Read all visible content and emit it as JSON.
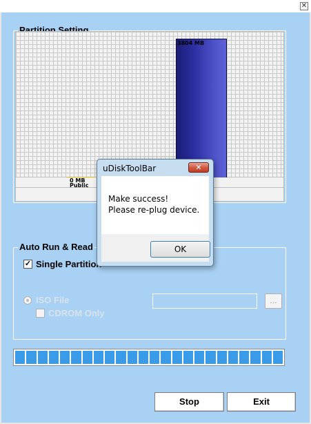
{
  "window": {
    "close_glyph": "✕",
    "accent_color": "#a9d1f4"
  },
  "partition": {
    "title": "Partition Setting",
    "public_label": "0 MB",
    "public_name": "Public",
    "secure_label": "3804 MB"
  },
  "autorun": {
    "title": "Auto Run & Read",
    "single_partition_label": "Single Partition",
    "single_partition_checked": true,
    "iso_file_label": "ISO File",
    "cdrom_only_label": "CDROM Only",
    "iso_path_value": "",
    "browse_label": "..."
  },
  "progress": {
    "segments": 24,
    "fill_fraction": 1.0,
    "color": "#3a9ce8"
  },
  "buttons": {
    "stop_label": "Stop",
    "exit_label": "Exit"
  },
  "dialog": {
    "title": "uDiskToolBar",
    "close_glyph": "✕",
    "line1": "Make success!",
    "line2": "Please re-plug device.",
    "ok_label": "OK"
  }
}
